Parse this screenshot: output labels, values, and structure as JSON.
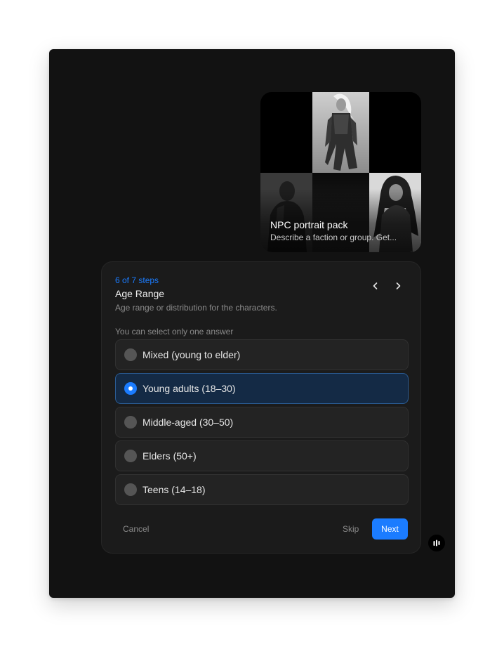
{
  "card": {
    "title": "NPC portrait pack",
    "description": "Describe a faction or group. Get..."
  },
  "question": {
    "step_label": "6 of 7 steps",
    "title": "Age Range",
    "description": "Age range or distribution for the characters.",
    "hint": "You can select only one answer",
    "options": [
      {
        "label": "Mixed (young to elder)",
        "selected": false
      },
      {
        "label": "Young adults (18–30)",
        "selected": true
      },
      {
        "label": "Middle-aged (30–50)",
        "selected": false
      },
      {
        "label": "Elders (50+)",
        "selected": false
      },
      {
        "label": "Teens (14–18)",
        "selected": false
      }
    ]
  },
  "actions": {
    "cancel_label": "Cancel",
    "skip_label": "Skip",
    "next_label": "Next"
  },
  "icons": {
    "prev": "chevron-left-icon",
    "next": "chevron-right-icon",
    "assistant": "audio-bars-icon"
  },
  "colors": {
    "accent": "#1b7cff",
    "window_bg": "#121212",
    "panel_bg": "#1b1b1b",
    "selected_bg": "#142a45"
  }
}
